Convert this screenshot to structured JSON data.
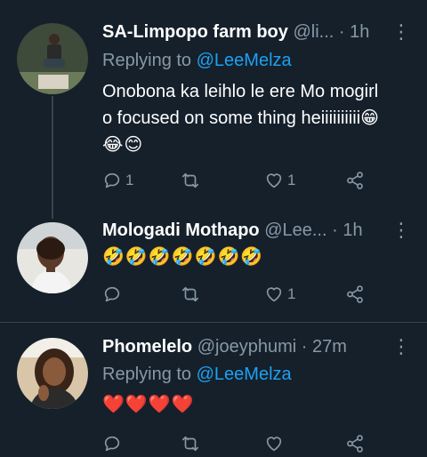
{
  "tweets": [
    {
      "name": "SA-Limpopo farm boy",
      "handle": "@li...",
      "dot": "·",
      "time": "1h",
      "more": "⋮",
      "replying_prefix": "Replying to",
      "replying_to": "@LeeMelza",
      "text_line1": "Onobona ka leihlo le ere Mo mogirl",
      "text_line2": "o focused on some thing heiiiiiiiiii😁",
      "text_line3": "😂😊",
      "reply_count": "1",
      "retweet_count": "",
      "like_count": "1"
    },
    {
      "name": "Mologadi Mothapo",
      "handle": "@Lee...",
      "dot": "·",
      "time": "1h",
      "more": "⋮",
      "text_line1": "🤣🤣🤣🤣🤣🤣🤣",
      "reply_count": "",
      "retweet_count": "",
      "like_count": "1"
    },
    {
      "name": "Phomelelo",
      "handle": "@joeyphumi",
      "dot": "·",
      "time": "27m",
      "more": "⋮",
      "replying_prefix": "Replying to",
      "replying_to": "@LeeMelza",
      "text_line1": "❤️❤️❤️❤️",
      "reply_count": "",
      "retweet_count": "",
      "like_count": ""
    }
  ],
  "icons": {
    "reply": "reply-icon",
    "retweet": "retweet-icon",
    "like": "heart-icon",
    "share": "share-icon"
  },
  "colors": {
    "background": "#15202b",
    "name": "#ffffff",
    "secondary": "#8899a6",
    "link": "#1da1f2",
    "divider": "#38444d"
  }
}
